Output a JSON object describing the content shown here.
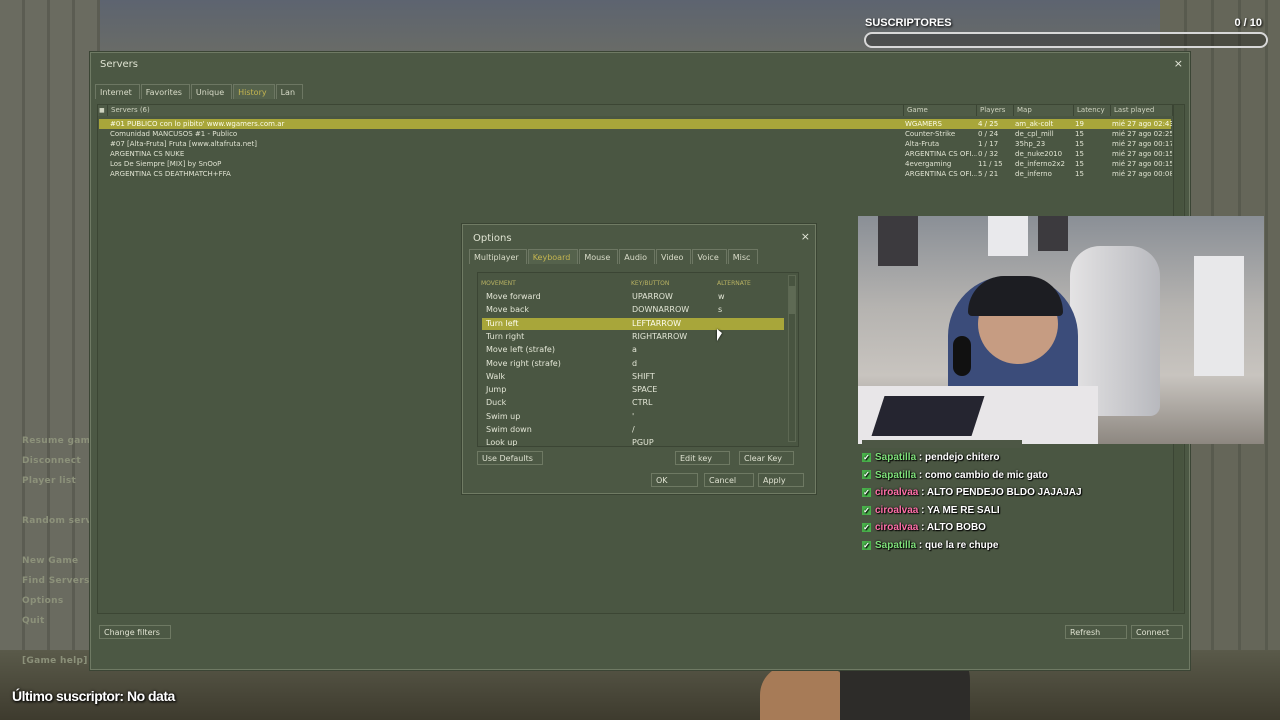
{
  "overlay": {
    "subs_title": "SUSCRIPTORES",
    "subs_count": "0 / 10",
    "subs_progress": 0,
    "last_sub": "Último suscriptor: No data"
  },
  "game_menu": {
    "items": [
      "Resume game",
      "Disconnect",
      "Player list",
      "Random server",
      "New Game",
      "Find Servers",
      "Options",
      "Quit",
      "[Game help]"
    ]
  },
  "servers_window": {
    "title": "Servers",
    "close": "×",
    "tabs": [
      "Internet",
      "Favorites",
      "Unique",
      "History",
      "Lan"
    ],
    "active_tab": "History",
    "columns": {
      "lock": "🔒",
      "servers": "Servers (6)",
      "game": "Game",
      "players": "Players",
      "map": "Map",
      "latency": "Latency",
      "last_played": "Last played"
    },
    "rows": [
      {
        "name": "#01 PUBLICO con lo pibito' www.wgamers.com.ar",
        "game": "WGAMERS",
        "players": "4 / 25",
        "map": "am_ak-colt",
        "latency": "19",
        "last": "mié 27 ago 02:43"
      },
      {
        "name": "Comunidad MANCUSOS #1  - Publico",
        "game": "Counter-Strike",
        "players": "0 / 24",
        "map": "de_cpl_mill",
        "latency": "15",
        "last": "mié 27 ago 02:25"
      },
      {
        "name": "#07 [Alta-Fruta] Fruta [www.altafruta.net]",
        "game": "Alta-Fruta",
        "players": "1 / 17",
        "map": "35hp_23",
        "latency": "15",
        "last": "mié 27 ago 00:17"
      },
      {
        "name": "ARGENTINA CS NUKE",
        "game": "ARGENTINA CS OFI...",
        "players": "0 / 32",
        "map": "de_nuke2010",
        "latency": "15",
        "last": "mié 27 ago 00:15"
      },
      {
        "name": "Los De Siempre [MIX] by SnOoP",
        "game": "4evergaming",
        "players": "11 / 15",
        "map": "de_inferno2x2",
        "latency": "15",
        "last": "mié 27 ago 00:15"
      },
      {
        "name": "ARGENTINA CS DEATHMATCH+FFA",
        "game": "ARGENTINA CS OFI...",
        "players": "5 / 21",
        "map": "de_inferno",
        "latency": "15",
        "last": "mié 27 ago 00:08"
      }
    ],
    "buttons": {
      "change_filters": "Change filters",
      "refresh": "Refresh",
      "connect": "Connect"
    }
  },
  "options_dialog": {
    "title": "Options",
    "close": "×",
    "tabs": [
      "Multiplayer",
      "Keyboard",
      "Mouse",
      "Audio",
      "Video",
      "Voice",
      "Misc"
    ],
    "active_tab": "Keyboard",
    "headers": {
      "action": "MOVEMENT",
      "key": "KEY/BUTTON",
      "alt": "ALTERNATE"
    },
    "bindings": [
      {
        "action": "Move forward",
        "key": "UPARROW",
        "alt": "w"
      },
      {
        "action": "Move back",
        "key": "DOWNARROW",
        "alt": "s"
      },
      {
        "action": "Turn left",
        "key": "LEFTARROW",
        "alt": ""
      },
      {
        "action": "Turn right",
        "key": "RIGHTARROW",
        "alt": ""
      },
      {
        "action": "Move left (strafe)",
        "key": "a",
        "alt": ""
      },
      {
        "action": "Move right (strafe)",
        "key": "d",
        "alt": ""
      },
      {
        "action": "Walk",
        "key": "SHIFT",
        "alt": ""
      },
      {
        "action": "Jump",
        "key": "SPACE",
        "alt": ""
      },
      {
        "action": "Duck",
        "key": "CTRL",
        "alt": ""
      },
      {
        "action": "Swim up",
        "key": "'",
        "alt": ""
      },
      {
        "action": "Swim down",
        "key": "/",
        "alt": ""
      },
      {
        "action": "Look up",
        "key": "PGUP",
        "alt": ""
      }
    ],
    "selected_binding": 2,
    "buttons": {
      "use_defaults": "Use Defaults",
      "edit_key": "Edit key",
      "clear_key": "Clear Key",
      "ok": "OK",
      "cancel": "Cancel",
      "apply": "Apply"
    }
  },
  "chat": {
    "messages": [
      {
        "user": "Sapatilla",
        "text": "pendejo chitero",
        "color": "#7fe07a"
      },
      {
        "user": "Sapatilla",
        "text": "como cambio de mic gato",
        "color": "#7fe07a"
      },
      {
        "user": "ciroalvaa",
        "text": "ALTO PENDEJO BLDO JAJAJAJ",
        "color": "#ff6fa8"
      },
      {
        "user": "ciroalvaa",
        "text": "YA ME RE SALI",
        "color": "#ff6fa8"
      },
      {
        "user": "ciroalvaa",
        "text": "ALTO BOBO",
        "color": "#ff6fa8"
      },
      {
        "user": "Sapatilla",
        "text": "que la re chupe",
        "color": "#7fe07a"
      }
    ]
  },
  "colors": {
    "selected_row": "#a8a63a",
    "panel": "#4c5844",
    "active_tab_text": "#c4b550"
  }
}
